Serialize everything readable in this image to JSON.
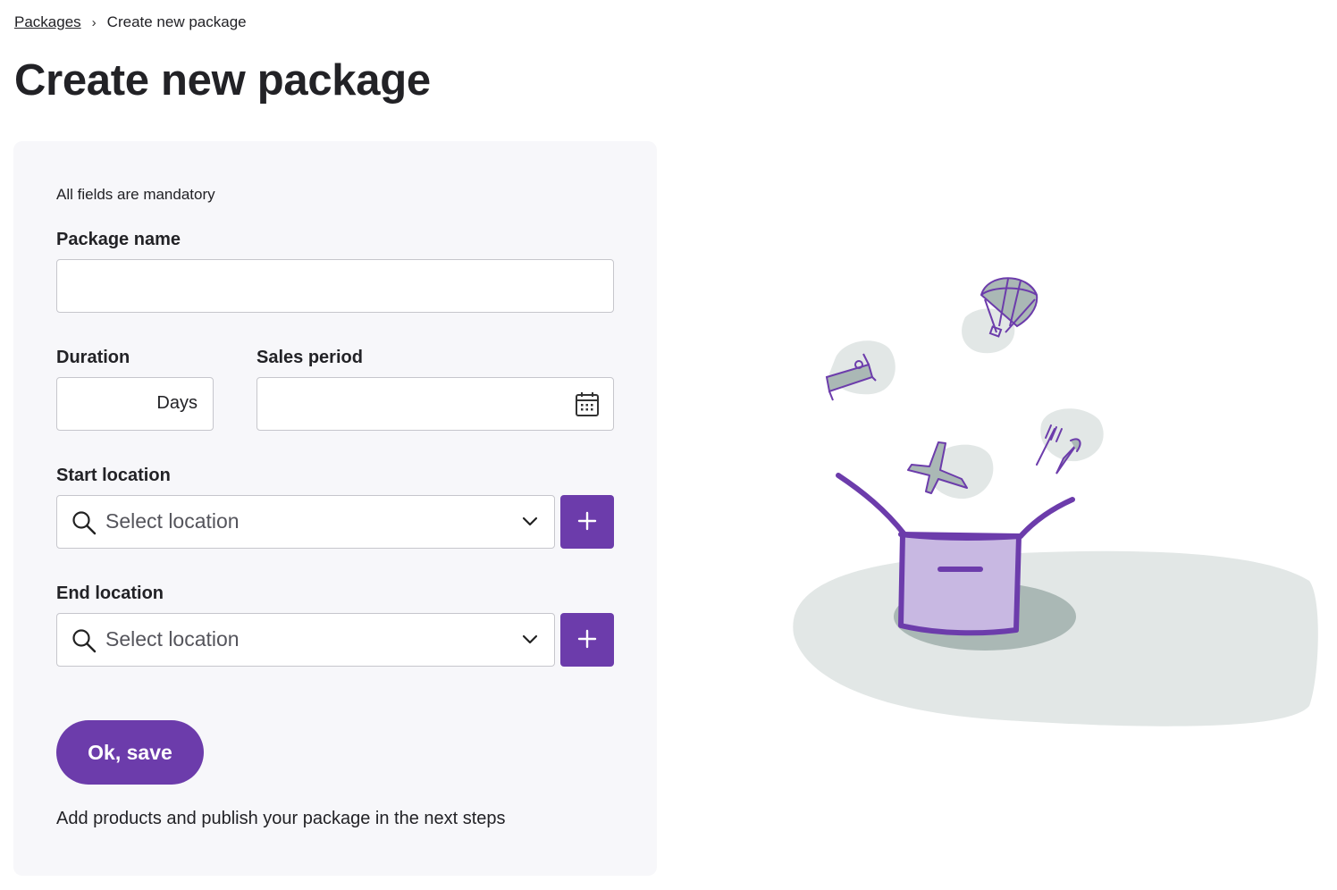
{
  "breadcrumb": {
    "parent": "Packages",
    "separator": "›",
    "current": "Create new package"
  },
  "page": {
    "title": "Create new package"
  },
  "form": {
    "mandatory_hint": "All fields are mandatory",
    "package_name": {
      "label": "Package name",
      "value": ""
    },
    "duration": {
      "label": "Duration",
      "value": "",
      "suffix": "Days"
    },
    "sales_period": {
      "label": "Sales period",
      "value": ""
    },
    "start_location": {
      "label": "Start location",
      "placeholder": "Select location"
    },
    "end_location": {
      "label": "End location",
      "placeholder": "Select location"
    },
    "save_label": "Ok, save",
    "footnote": "Add products and publish your package in the next steps"
  },
  "icons": {
    "calendar": "calendar-icon",
    "search": "search-icon",
    "chevron": "chevron-down-icon",
    "plus": "plus-icon"
  },
  "colors": {
    "accent": "#6c3cab",
    "box_fill": "#c8b8e2",
    "ground": "#e2e7e6",
    "shadow": "#aab8b5",
    "card_bg": "#f7f7fa"
  }
}
